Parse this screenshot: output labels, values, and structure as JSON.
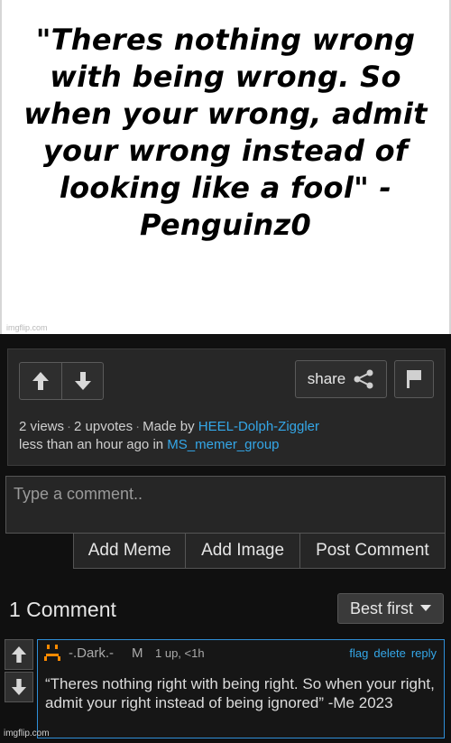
{
  "meme": {
    "caption": "\"Theres nothing wrong with being wrong. So when your wrong, admit your wrong instead of looking like a fool\" - Penguinz0",
    "watermark": "imgflip.com"
  },
  "post": {
    "share_label": "share",
    "views": "2 views",
    "upvotes": "2 upvotes",
    "made_by_prefix": "Made by",
    "author": "HEEL-Dolph-Ziggler",
    "time_prefix": "less than an hour ago in",
    "stream": "MS_memer_group"
  },
  "composer": {
    "placeholder": "Type a comment..",
    "add_meme": "Add Meme",
    "add_image": "Add Image",
    "post_comment": "Post Comment"
  },
  "comments": {
    "count_label": "1 Comment",
    "sort_selected": "Best first",
    "items": [
      {
        "user": "-.Dark.-",
        "badge": "M",
        "meta": "1 up, <1h",
        "flag": "flag",
        "delete": "delete",
        "reply": "reply",
        "text": "“Theres nothing right with being right. So when your right, admit your right instead of being ignored” -Me 2023"
      }
    ]
  },
  "footer": {
    "watermark": "imgflip.com"
  },
  "colors": {
    "link": "#34a7e8",
    "background": "#101010",
    "avatar": "#ff8a00"
  },
  "icons": [
    "upvote-arrow-icon",
    "downvote-arrow-icon",
    "share-icon",
    "flag-icon",
    "dropdown-caret-icon",
    "avatar-icon"
  ]
}
